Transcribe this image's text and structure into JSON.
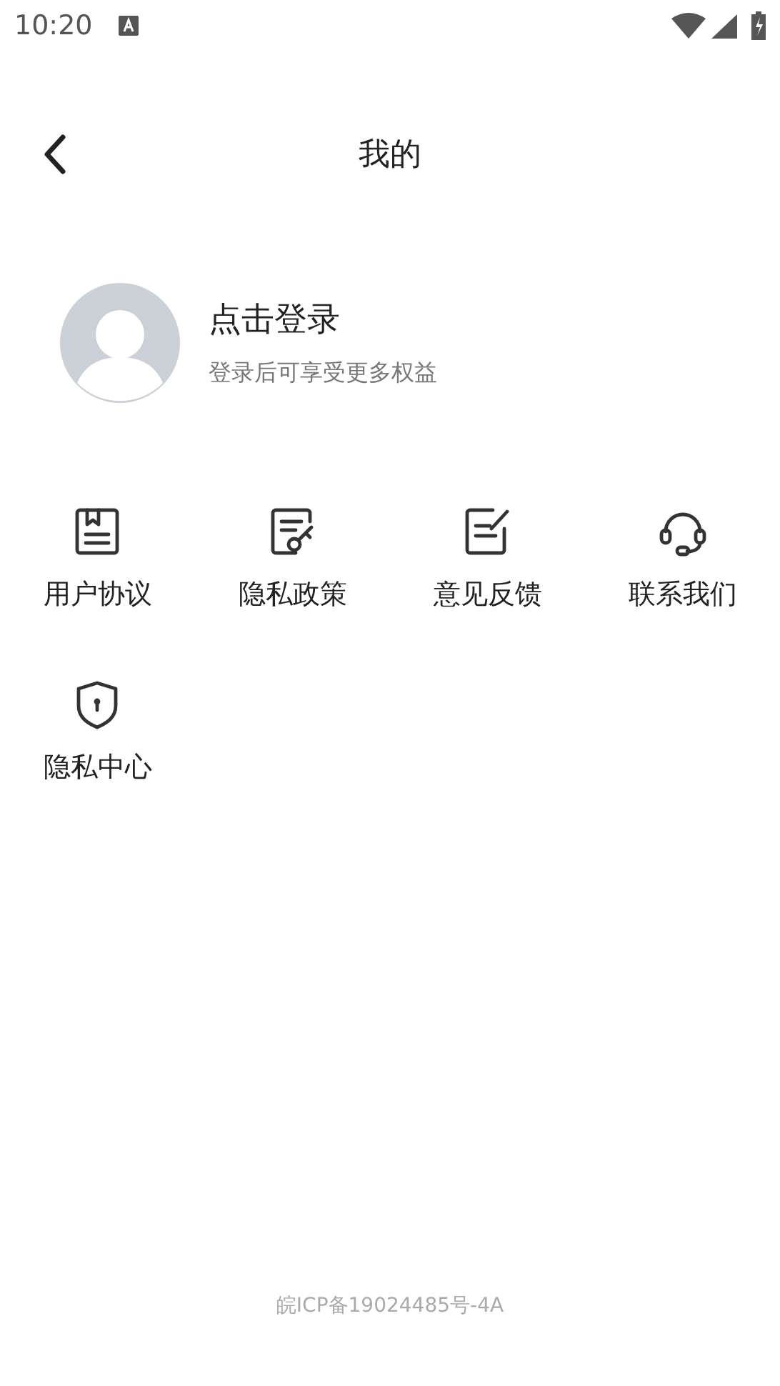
{
  "status_bar": {
    "time": "10:20"
  },
  "header": {
    "title": "我的"
  },
  "profile": {
    "name": "点击登录",
    "subtitle": "登录后可享受更多权益"
  },
  "menu": [
    {
      "kind": "agreement",
      "label": "用户协议"
    },
    {
      "kind": "policy",
      "label": "隐私政策"
    },
    {
      "kind": "feedback",
      "label": "意见反馈"
    },
    {
      "kind": "contact",
      "label": "联系我们"
    },
    {
      "kind": "privacy",
      "label": "隐私中心"
    }
  ],
  "footer": {
    "icp": "皖ICP备19024485号-4A"
  }
}
